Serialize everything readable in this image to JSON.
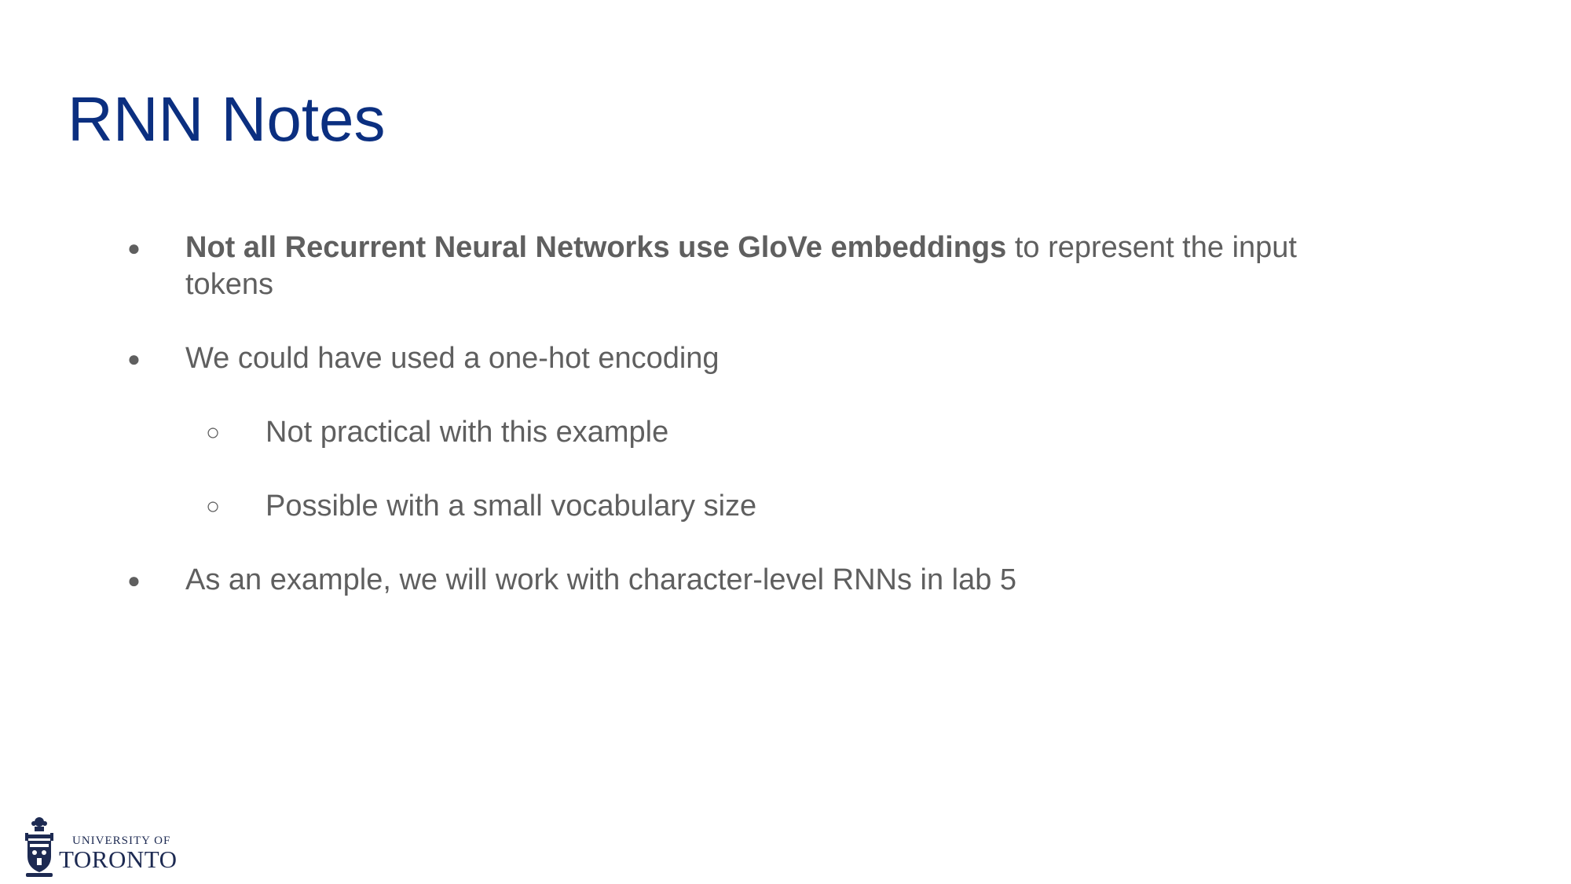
{
  "slide": {
    "title": "RNN Notes",
    "bullets": [
      {
        "marker": "●",
        "bold_text": "Not all Recurrent Neural Networks use GloVe embeddings",
        "text": " to represent the input tokens"
      },
      {
        "marker": "●",
        "text": "We could have used a one-hot encoding"
      },
      {
        "marker": "○",
        "text": "Not practical with this example"
      },
      {
        "marker": "○",
        "text": "Possible with a small vocabulary size"
      },
      {
        "marker": "●",
        "text": "As an example, we will work with character-level RNNs in lab 5"
      }
    ]
  },
  "logo": {
    "line1": "UNIVERSITY OF",
    "line2": "TORONTO",
    "icon": "university-crest-icon"
  },
  "colors": {
    "title": "#0b2f80",
    "body_text": "#5f5f5f",
    "logo": "#1d2a52"
  }
}
